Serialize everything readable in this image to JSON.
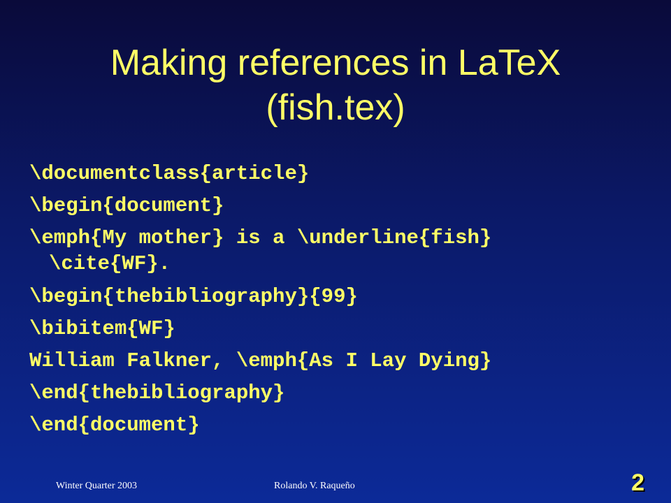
{
  "slide": {
    "title_line1": "Making references in LaTeX",
    "title_line2": "(fish.tex)",
    "code_lines": [
      "\\documentclass{article}",
      "\\begin{document}",
      "\\emph{My mother} is a \\underline{fish}",
      "\\cite{WF}.",
      "\\begin{thebibliography}{99}",
      "\\bibitem{WF}",
      "William Falkner, \\emph{As I Lay Dying}",
      "\\end{thebibliography}",
      "\\end{document}"
    ],
    "footer_left": "Winter Quarter 2003",
    "footer_center": "Rolando V. Raqueño",
    "page_number": "2"
  },
  "colors": {
    "text_accent": "#ffff66",
    "background_top": "#0a0a3a",
    "background_bottom": "#0c2a98",
    "footer_text": "#ffffff"
  }
}
